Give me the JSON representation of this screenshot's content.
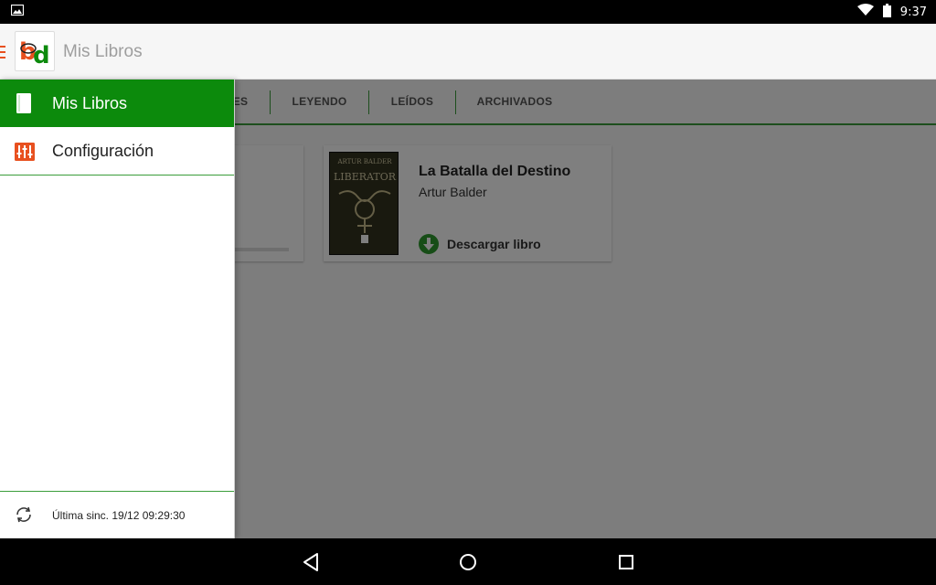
{
  "status_bar": {
    "time": "9:37",
    "icons": [
      "image-notification-icon",
      "wifi-icon",
      "battery-icon"
    ]
  },
  "action_bar": {
    "title": "Mis Libros",
    "logo_text": "bd"
  },
  "tabs": [
    {
      "label": "ES"
    },
    {
      "label": "LEYENDO"
    },
    {
      "label": "LEÍDOS"
    },
    {
      "label": "ARCHIVADOS"
    }
  ],
  "book": {
    "title": "La Batalla del Destino",
    "author": "Artur Balder",
    "download_label": "Descargar libro",
    "cover_author": "ARTUR BALDER",
    "cover_title": "LIBERATOR"
  },
  "drawer": {
    "items": [
      {
        "label": "Mis Libros",
        "icon": "book-icon",
        "active": true
      },
      {
        "label": "Configuración",
        "icon": "settings-sliders-icon",
        "active": false
      }
    ],
    "sync_label": "Última sinc. 19/12 09:29:30"
  },
  "colors": {
    "accent_green": "#0c8a0c",
    "accent_orange": "#e8501f",
    "download_green": "#2e9b2e"
  }
}
